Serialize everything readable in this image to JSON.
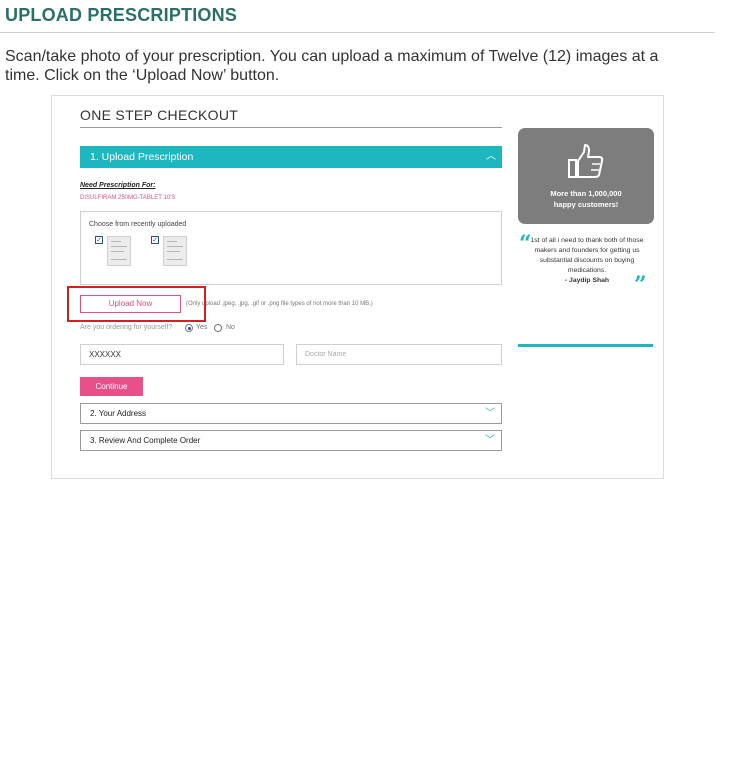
{
  "page": {
    "heading": "UPLOAD PRESCRIPTIONS",
    "intro": "Scan/take photo of your prescription. You can upload a maximum of Twelve (12) images at a time. Click on the ‘Upload Now’ button."
  },
  "checkout": {
    "title": "ONE STEP CHECKOUT",
    "step1": {
      "label": "1.  Upload Prescription",
      "icon": "chevron-up-icon"
    },
    "need_label": "Need Prescription For:",
    "medicine": "DISULFIRAM 250MG-TABLET 10'S",
    "recent_label": "Choose from recently uploaded",
    "recent_items": [
      {
        "checked": true
      },
      {
        "checked": true
      }
    ],
    "upload_button": "Upload Now",
    "upload_note": "(Only upload .jpeg, .jpg, .gif or .png file types of not more than 10 MB.)",
    "ordering_question": "Are you ordering for yourself?",
    "radio_yes": "Yes",
    "radio_no": "No",
    "selected_option": "Yes",
    "patient_name_value": "XXXXXX",
    "doctor_placeholder": "Doctor Name",
    "continue_button": "Continue",
    "step2": {
      "label": "2.  Your Address",
      "icon": "chevron-down-icon"
    },
    "step3": {
      "label": "3.  Review And Complete Order",
      "icon": "chevron-down-icon"
    }
  },
  "sidebar": {
    "promo_icon": "thumbs-up-icon",
    "promo_line1": "More than 1,000,000",
    "promo_line2": "happy customers!",
    "quote_text": "1st of all i need to thank both of those makers and founders for getting us substantial discounts on buying medications.",
    "quote_author": "- Jaydip Shah"
  },
  "colors": {
    "accent": "#1fb7bf",
    "brand_pink": "#e8508a",
    "heading_green": "#2a6f6a",
    "highlight_red": "#d32020"
  }
}
